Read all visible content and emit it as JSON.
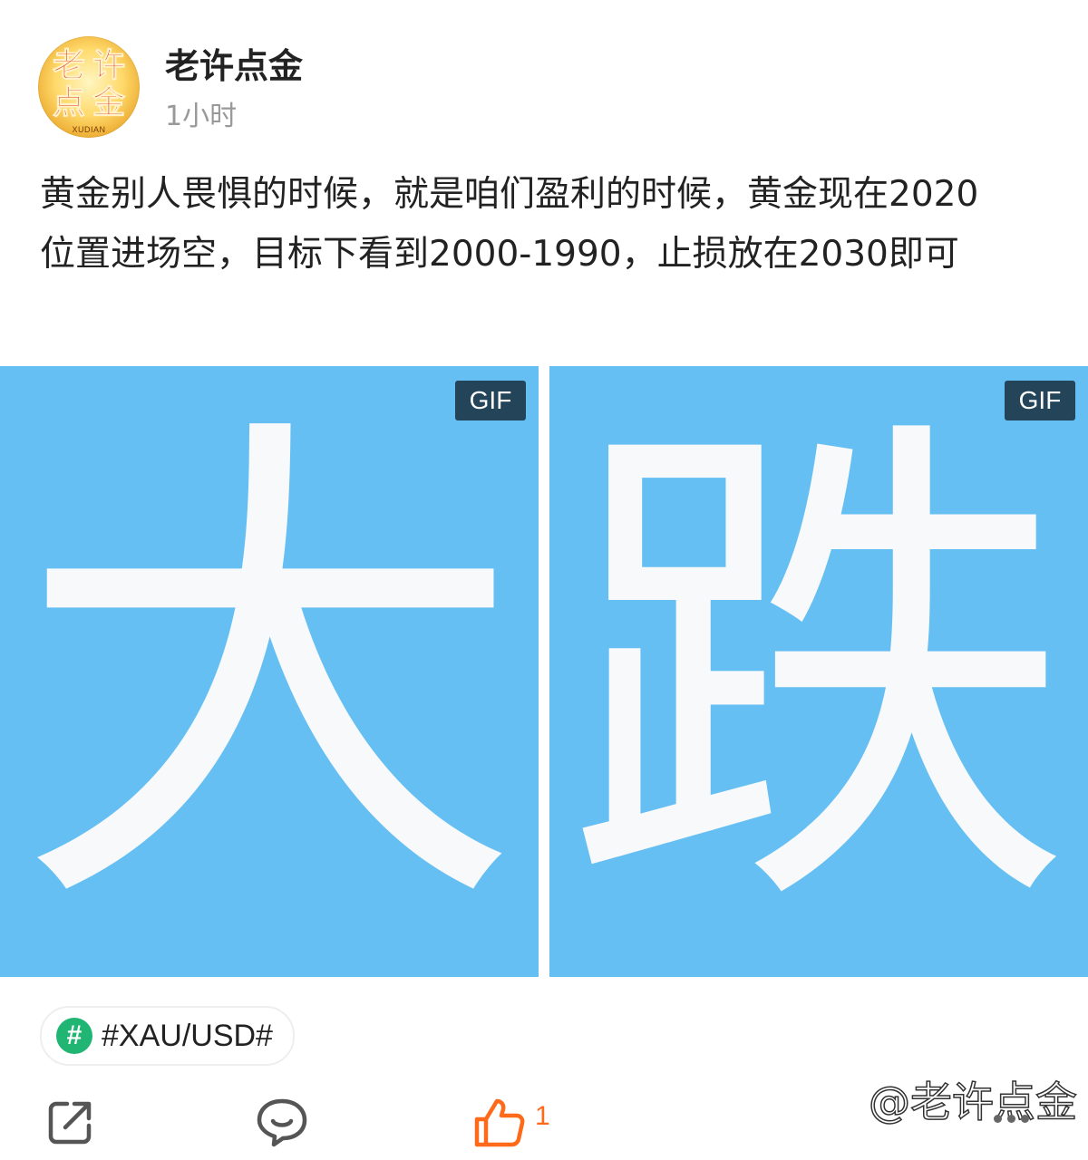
{
  "author": {
    "name": "老许点金",
    "avatar_text": [
      "老",
      "许",
      "点",
      "金"
    ],
    "avatar_subtext": "XUDIAN",
    "time": "1小时"
  },
  "post": {
    "text": "黄金别人畏惧的时候，就是咱们盈利的时候，黄金现在2020位置进场空，目标下看到2000-1990，止损放在2030即可"
  },
  "media": [
    {
      "char": "大",
      "badge": "GIF",
      "background": "#66bff3"
    },
    {
      "char": "跌",
      "badge": "GIF",
      "background": "#66bff3"
    }
  ],
  "topic": {
    "icon": "hash-icon",
    "icon_glyph": "#",
    "label": "#XAU/USD#"
  },
  "actions": {
    "share_icon": "share-icon",
    "comment_icon": "comment-icon",
    "like_icon": "thumbs-up-icon",
    "like_count": "1",
    "like_color": "#ff6a1a"
  },
  "watermark": "@老许点金",
  "colors": {
    "media_bg": "#66bff3",
    "badge_bg": "#234459",
    "topic_icon_bg": "#21b573",
    "muted_text": "#999999"
  }
}
